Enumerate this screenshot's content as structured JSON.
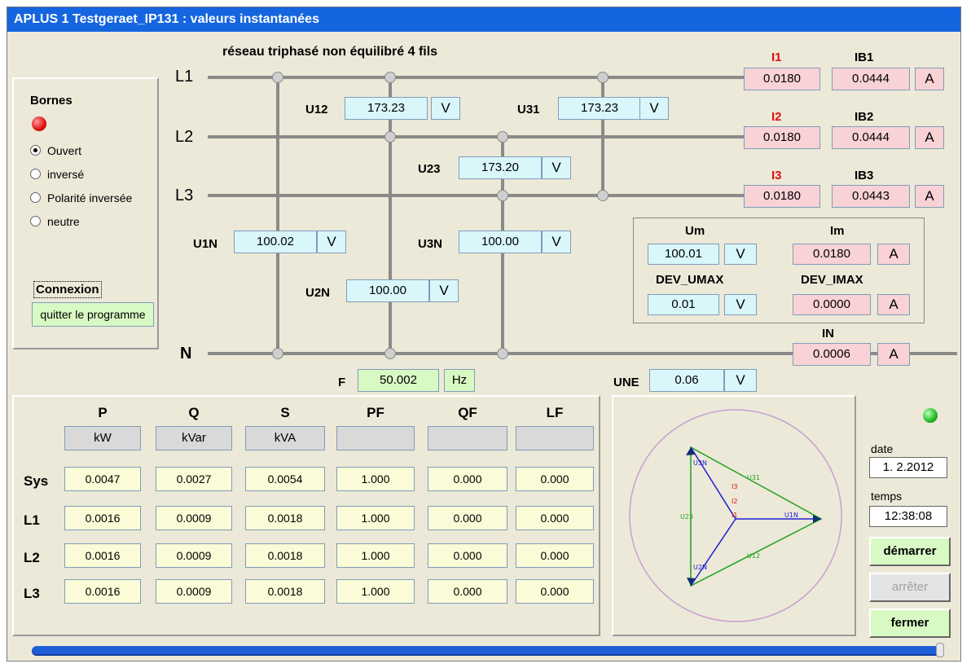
{
  "window": {
    "title": "APLUS 1 Testgeraet_IP131  : valeurs instantanées"
  },
  "network": {
    "title": "réseau triphasé non équilibré 4 fils",
    "lines": {
      "l1": "L1",
      "l2": "L2",
      "l3": "L3",
      "n": "N"
    },
    "u12": {
      "label": "U12",
      "value": "173.23",
      "unit": "V"
    },
    "u31": {
      "label": "U31",
      "value": "173.23",
      "unit": "V"
    },
    "u23": {
      "label": "U23",
      "value": "173.20",
      "unit": "V"
    },
    "u1n": {
      "label": "U1N",
      "value": "100.02",
      "unit": "V"
    },
    "u3n": {
      "label": "U3N",
      "value": "100.00",
      "unit": "V"
    },
    "u2n": {
      "label": "U2N",
      "value": "100.00",
      "unit": "V"
    },
    "freq": {
      "label": "F",
      "value": "50.002",
      "unit": "Hz"
    },
    "une": {
      "label": "UNE",
      "value": "0.06",
      "unit": "V"
    }
  },
  "currents": {
    "i1": {
      "label": "I1",
      "value": "0.0180"
    },
    "ib1": {
      "label": "IB1",
      "value": "0.0444"
    },
    "i2": {
      "label": "I2",
      "value": "0.0180"
    },
    "ib2": {
      "label": "IB2",
      "value": "0.0444"
    },
    "i3": {
      "label": "I3",
      "value": "0.0180"
    },
    "ib3": {
      "label": "IB3",
      "value": "0.0443"
    },
    "in": {
      "label": "IN",
      "value": "0.0006"
    },
    "unit": "A"
  },
  "summary": {
    "um": {
      "label": "Um",
      "value": "100.01",
      "unit": "V"
    },
    "im": {
      "label": "Im",
      "value": "0.0180",
      "unit": "A"
    },
    "dev_umax": {
      "label": "DEV_UMAX",
      "value": "0.01",
      "unit": "V"
    },
    "dev_imax": {
      "label": "DEV_IMAX",
      "value": "0.0000",
      "unit": "A"
    }
  },
  "bornes": {
    "title": "Bornes",
    "options": [
      "Ouvert",
      "inversé",
      "Polarité inversée",
      "neutre"
    ],
    "selected": "Ouvert",
    "connexion_label": "Connexion",
    "quit_label": "quitter le programme"
  },
  "power": {
    "headers": [
      "P",
      "Q",
      "S",
      "PF",
      "QF",
      "LF"
    ],
    "units": [
      "kW",
      "kVar",
      "kVA",
      "",
      "",
      ""
    ],
    "rows": [
      {
        "label": "Sys",
        "values": [
          "0.0047",
          "0.0027",
          "0.0054",
          "1.000",
          "0.000",
          "0.000"
        ]
      },
      {
        "label": "L1",
        "values": [
          "0.0016",
          "0.0009",
          "0.0018",
          "1.000",
          "0.000",
          "0.000"
        ]
      },
      {
        "label": "L2",
        "values": [
          "0.0016",
          "0.0009",
          "0.0018",
          "1.000",
          "0.000",
          "0.000"
        ]
      },
      {
        "label": "L3",
        "values": [
          "0.0016",
          "0.0009",
          "0.0018",
          "1.000",
          "0.000",
          "0.000"
        ]
      }
    ]
  },
  "phasor": {
    "labels": {
      "u3n": "U3N",
      "u31": "U31",
      "u23": "U23",
      "u1n": "U1N",
      "u12": "U12",
      "u2n": "U2N",
      "i1": "I1",
      "i2": "I2",
      "i3": "I3"
    }
  },
  "controls": {
    "date_label": "date",
    "date_value": "1. 2.2012",
    "time_label": "temps",
    "time_value": "12:38:08",
    "start_label": "démarrer",
    "stop_label": "arrêter",
    "close_label": "fermer"
  },
  "colors": {
    "title_bar": "#1565e0",
    "status_led": "#22bb22",
    "bornes_led": "#e01010",
    "progress": "#1f5fd8"
  }
}
